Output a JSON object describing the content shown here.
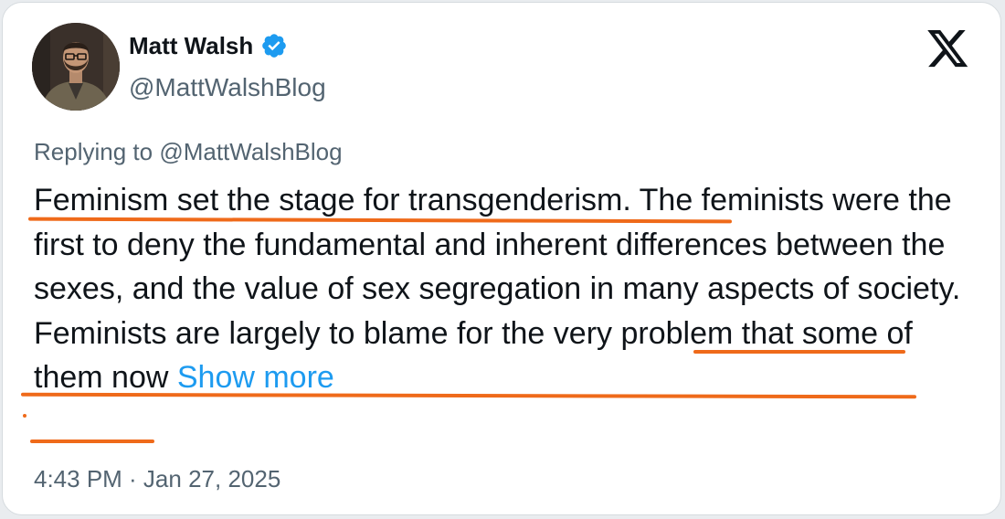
{
  "author": {
    "display_name": "Matt Walsh",
    "handle": "@MattWalshBlog",
    "verified_icon": "verified-badge-icon",
    "avatar_icon": "profile-photo"
  },
  "platform": {
    "logo_icon": "x-logo-icon"
  },
  "tweet": {
    "reply_prefix": "Replying to ",
    "reply_handle": "@MattWalshBlog",
    "text_segment_1": "Feminism set the stage for transgenderism",
    "text_segment_2": ". The feminists were the first to deny the fundamental and inherent differences between the sexes, and the value of sex segregation in many aspects of society. ",
    "text_segment_3": "Feminists are largely to blame for the very problem that some of them now",
    "show_more_label": "Show more",
    "timestamp": "4:43 PM · Jan 27, 2025"
  },
  "colors": {
    "text_primary": "#0f1419",
    "text_secondary": "#536471",
    "link_blue": "#1d9bf0",
    "verified_blue": "#1d9bf0",
    "annotation_orange": "#ef6a1a"
  }
}
